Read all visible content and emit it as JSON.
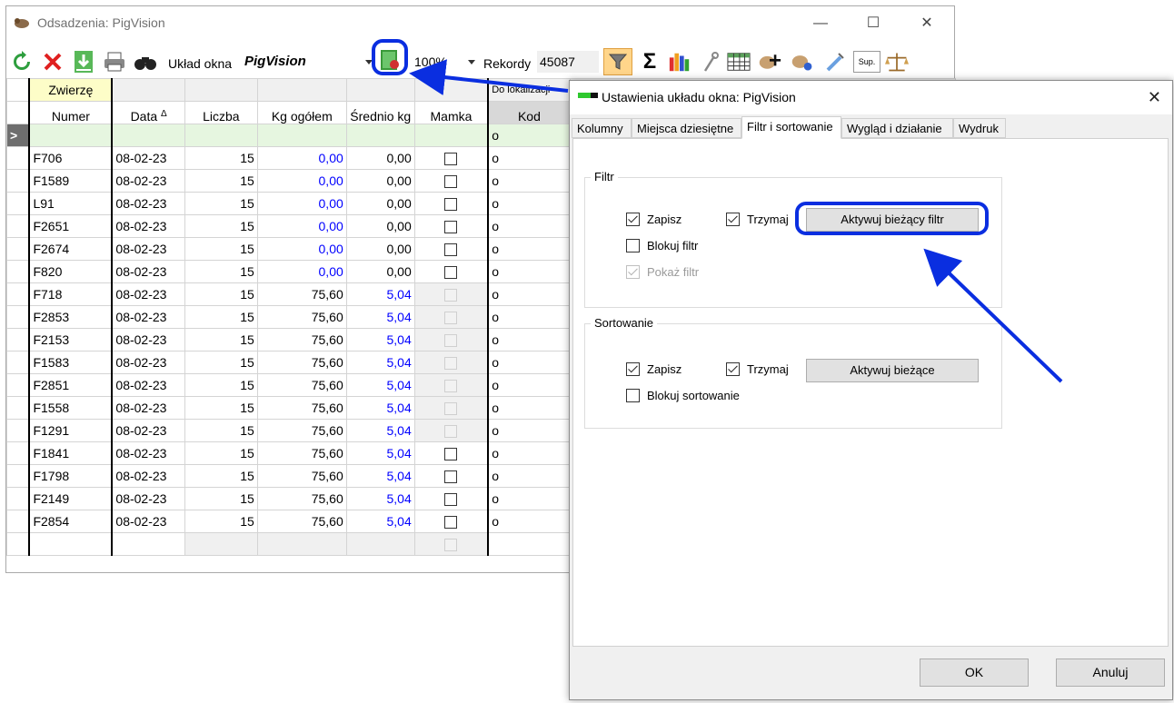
{
  "main": {
    "title": "Odsadzenia: PigVision",
    "toolbar": {
      "layout_label": "Układ okna",
      "layout_value": "PigVision",
      "zoom_value": "100%",
      "records_label": "Rekordy",
      "records_value": "45087",
      "sigma": "Σ",
      "sup_label": "Sup."
    },
    "grid": {
      "group_header": "Zwierzę",
      "group_header_2": "Do lokalizacji",
      "columns": [
        "Numer",
        "Data",
        "Liczba",
        "Kg ogółem",
        "Średnio kg",
        "Mamka",
        "Kod"
      ],
      "sort_indicator": "Δ",
      "filter_indicator": ">",
      "filter_kod": "o",
      "rows": [
        {
          "numer": "F706",
          "data": "08-02-23",
          "liczba": "15",
          "kg": "0,00",
          "avg": "0,00",
          "kod": "o"
        },
        {
          "numer": "F1589",
          "data": "08-02-23",
          "liczba": "15",
          "kg": "0,00",
          "avg": "0,00",
          "kod": "o"
        },
        {
          "numer": "L91",
          "data": "08-02-23",
          "liczba": "15",
          "kg": "0,00",
          "avg": "0,00",
          "kod": "o"
        },
        {
          "numer": "F2651",
          "data": "08-02-23",
          "liczba": "15",
          "kg": "0,00",
          "avg": "0,00",
          "kod": "o"
        },
        {
          "numer": "F2674",
          "data": "08-02-23",
          "liczba": "15",
          "kg": "0,00",
          "avg": "0,00",
          "kod": "o"
        },
        {
          "numer": "F820",
          "data": "08-02-23",
          "liczba": "15",
          "kg": "0,00",
          "avg": "0,00",
          "kod": "o"
        },
        {
          "numer": "F718",
          "data": "08-02-23",
          "liczba": "15",
          "kg": "75,60",
          "avg": "5,04",
          "kod": "o"
        },
        {
          "numer": "F2853",
          "data": "08-02-23",
          "liczba": "15",
          "kg": "75,60",
          "avg": "5,04",
          "kod": "o"
        },
        {
          "numer": "F2153",
          "data": "08-02-23",
          "liczba": "15",
          "kg": "75,60",
          "avg": "5,04",
          "kod": "o"
        },
        {
          "numer": "F1583",
          "data": "08-02-23",
          "liczba": "15",
          "kg": "75,60",
          "avg": "5,04",
          "kod": "o"
        },
        {
          "numer": "F2851",
          "data": "08-02-23",
          "liczba": "15",
          "kg": "75,60",
          "avg": "5,04",
          "kod": "o"
        },
        {
          "numer": "F1558",
          "data": "08-02-23",
          "liczba": "15",
          "kg": "75,60",
          "avg": "5,04",
          "kod": "o"
        },
        {
          "numer": "F1291",
          "data": "08-02-23",
          "liczba": "15",
          "kg": "75,60",
          "avg": "5,04",
          "kod": "o"
        },
        {
          "numer": "F1841",
          "data": "08-02-23",
          "liczba": "15",
          "kg": "75,60",
          "avg": "5,04",
          "kod": "o"
        },
        {
          "numer": "F1798",
          "data": "08-02-23",
          "liczba": "15",
          "kg": "75,60",
          "avg": "5,04",
          "kod": "o"
        },
        {
          "numer": "F2149",
          "data": "08-02-23",
          "liczba": "15",
          "kg": "75,60",
          "avg": "5,04",
          "kod": "o"
        },
        {
          "numer": "F2854",
          "data": "08-02-23",
          "liczba": "15",
          "kg": "75,60",
          "avg": "5,04",
          "kod": "o"
        }
      ]
    }
  },
  "dialog": {
    "title": "Ustawienia układu okna: PigVision",
    "tabs": [
      "Kolumny",
      "Miejsca dziesiętne",
      "Filtr i sortowanie",
      "Wygląd i działanie",
      "Wydruk"
    ],
    "active_tab": "Filtr i sortowanie",
    "filter_group": {
      "label": "Filtr",
      "save": "Zapisz",
      "keep": "Trzymaj",
      "lock": "Blokuj filtr",
      "show": "Pokaż filtr",
      "activate_button": "Aktywuj bieżący filtr"
    },
    "sort_group": {
      "label": "Sortowanie",
      "save": "Zapisz",
      "keep": "Trzymaj",
      "lock": "Blokuj sortowanie",
      "activate_button": "Aktywuj bieżące"
    },
    "ok_label": "OK",
    "cancel_label": "Anuluj"
  },
  "colors": {
    "annotation_blue": "#0a2ee0",
    "value_blue": "#0000ff",
    "filter_row_bg": "#e6f6e0",
    "group_header_bg": "#fdfdc8"
  }
}
